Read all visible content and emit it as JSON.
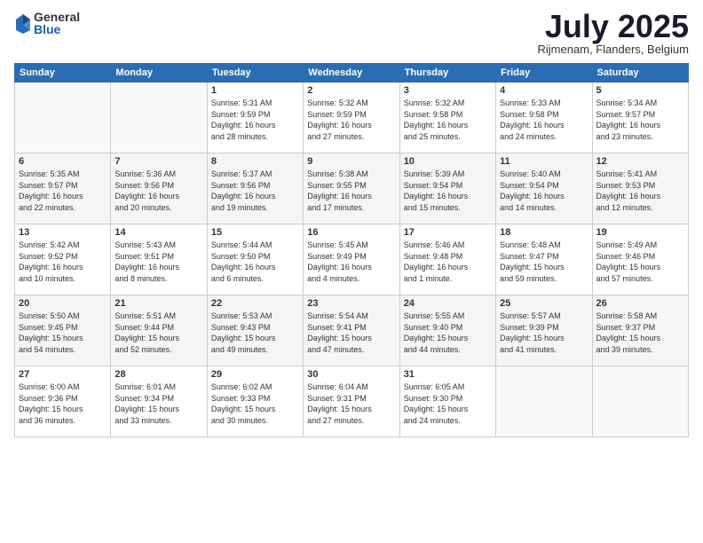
{
  "logo": {
    "general": "General",
    "blue": "Blue"
  },
  "title": "July 2025",
  "location": "Rijmenam, Flanders, Belgium",
  "headers": [
    "Sunday",
    "Monday",
    "Tuesday",
    "Wednesday",
    "Thursday",
    "Friday",
    "Saturday"
  ],
  "weeks": [
    [
      {
        "day": "",
        "info": ""
      },
      {
        "day": "",
        "info": ""
      },
      {
        "day": "1",
        "info": "Sunrise: 5:31 AM\nSunset: 9:59 PM\nDaylight: 16 hours\nand 28 minutes."
      },
      {
        "day": "2",
        "info": "Sunrise: 5:32 AM\nSunset: 9:59 PM\nDaylight: 16 hours\nand 27 minutes."
      },
      {
        "day": "3",
        "info": "Sunrise: 5:32 AM\nSunset: 9:58 PM\nDaylight: 16 hours\nand 25 minutes."
      },
      {
        "day": "4",
        "info": "Sunrise: 5:33 AM\nSunset: 9:58 PM\nDaylight: 16 hours\nand 24 minutes."
      },
      {
        "day": "5",
        "info": "Sunrise: 5:34 AM\nSunset: 9:57 PM\nDaylight: 16 hours\nand 23 minutes."
      }
    ],
    [
      {
        "day": "6",
        "info": "Sunrise: 5:35 AM\nSunset: 9:57 PM\nDaylight: 16 hours\nand 22 minutes."
      },
      {
        "day": "7",
        "info": "Sunrise: 5:36 AM\nSunset: 9:56 PM\nDaylight: 16 hours\nand 20 minutes."
      },
      {
        "day": "8",
        "info": "Sunrise: 5:37 AM\nSunset: 9:56 PM\nDaylight: 16 hours\nand 19 minutes."
      },
      {
        "day": "9",
        "info": "Sunrise: 5:38 AM\nSunset: 9:55 PM\nDaylight: 16 hours\nand 17 minutes."
      },
      {
        "day": "10",
        "info": "Sunrise: 5:39 AM\nSunset: 9:54 PM\nDaylight: 16 hours\nand 15 minutes."
      },
      {
        "day": "11",
        "info": "Sunrise: 5:40 AM\nSunset: 9:54 PM\nDaylight: 16 hours\nand 14 minutes."
      },
      {
        "day": "12",
        "info": "Sunrise: 5:41 AM\nSunset: 9:53 PM\nDaylight: 16 hours\nand 12 minutes."
      }
    ],
    [
      {
        "day": "13",
        "info": "Sunrise: 5:42 AM\nSunset: 9:52 PM\nDaylight: 16 hours\nand 10 minutes."
      },
      {
        "day": "14",
        "info": "Sunrise: 5:43 AM\nSunset: 9:51 PM\nDaylight: 16 hours\nand 8 minutes."
      },
      {
        "day": "15",
        "info": "Sunrise: 5:44 AM\nSunset: 9:50 PM\nDaylight: 16 hours\nand 6 minutes."
      },
      {
        "day": "16",
        "info": "Sunrise: 5:45 AM\nSunset: 9:49 PM\nDaylight: 16 hours\nand 4 minutes."
      },
      {
        "day": "17",
        "info": "Sunrise: 5:46 AM\nSunset: 9:48 PM\nDaylight: 16 hours\nand 1 minute."
      },
      {
        "day": "18",
        "info": "Sunrise: 5:48 AM\nSunset: 9:47 PM\nDaylight: 15 hours\nand 59 minutes."
      },
      {
        "day": "19",
        "info": "Sunrise: 5:49 AM\nSunset: 9:46 PM\nDaylight: 15 hours\nand 57 minutes."
      }
    ],
    [
      {
        "day": "20",
        "info": "Sunrise: 5:50 AM\nSunset: 9:45 PM\nDaylight: 15 hours\nand 54 minutes."
      },
      {
        "day": "21",
        "info": "Sunrise: 5:51 AM\nSunset: 9:44 PM\nDaylight: 15 hours\nand 52 minutes."
      },
      {
        "day": "22",
        "info": "Sunrise: 5:53 AM\nSunset: 9:43 PM\nDaylight: 15 hours\nand 49 minutes."
      },
      {
        "day": "23",
        "info": "Sunrise: 5:54 AM\nSunset: 9:41 PM\nDaylight: 15 hours\nand 47 minutes."
      },
      {
        "day": "24",
        "info": "Sunrise: 5:55 AM\nSunset: 9:40 PM\nDaylight: 15 hours\nand 44 minutes."
      },
      {
        "day": "25",
        "info": "Sunrise: 5:57 AM\nSunset: 9:39 PM\nDaylight: 15 hours\nand 41 minutes."
      },
      {
        "day": "26",
        "info": "Sunrise: 5:58 AM\nSunset: 9:37 PM\nDaylight: 15 hours\nand 39 minutes."
      }
    ],
    [
      {
        "day": "27",
        "info": "Sunrise: 6:00 AM\nSunset: 9:36 PM\nDaylight: 15 hours\nand 36 minutes."
      },
      {
        "day": "28",
        "info": "Sunrise: 6:01 AM\nSunset: 9:34 PM\nDaylight: 15 hours\nand 33 minutes."
      },
      {
        "day": "29",
        "info": "Sunrise: 6:02 AM\nSunset: 9:33 PM\nDaylight: 15 hours\nand 30 minutes."
      },
      {
        "day": "30",
        "info": "Sunrise: 6:04 AM\nSunset: 9:31 PM\nDaylight: 15 hours\nand 27 minutes."
      },
      {
        "day": "31",
        "info": "Sunrise: 6:05 AM\nSunset: 9:30 PM\nDaylight: 15 hours\nand 24 minutes."
      },
      {
        "day": "",
        "info": ""
      },
      {
        "day": "",
        "info": ""
      }
    ]
  ]
}
